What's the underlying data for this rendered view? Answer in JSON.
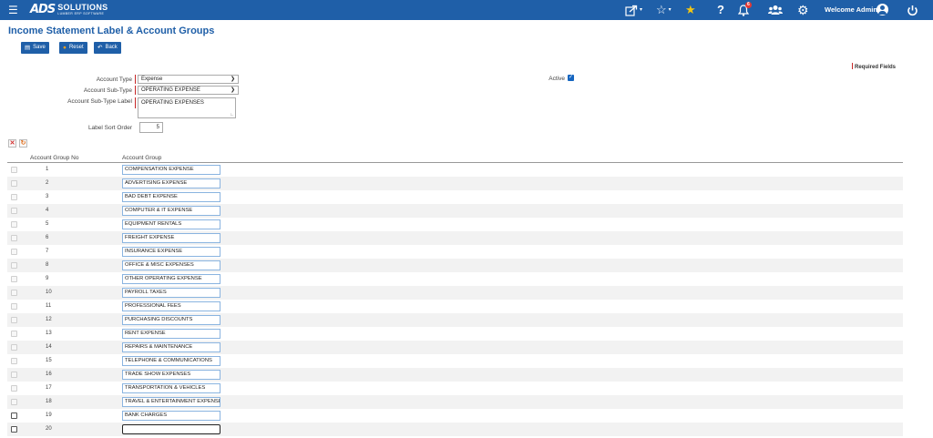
{
  "topbar": {
    "menu_icon": "hamburger-icon",
    "logo_mark": "ADS",
    "logo_name": "SOLUTIONS",
    "logo_tagline": "LUMBER ERP SOFTWARE",
    "icons": [
      "share-icon",
      "star-outline-icon",
      "star-filled-icon",
      "help-icon",
      "bell-icon",
      "users-icon",
      "gear-icon",
      "user-circle-icon",
      "power-icon"
    ],
    "notification_count": "6",
    "welcome_text": "Welcome Admin",
    "color": "#1f5fa8"
  },
  "page": {
    "title": "Income Statement Label & Account Groups",
    "buttons": {
      "save": "Save",
      "reset": "Reset",
      "back": "Back"
    },
    "required_fields": "Required Fields"
  },
  "form": {
    "account_type_label": "Account Type",
    "account_type_value": "Expense",
    "account_subtype_label": "Account Sub-Type",
    "account_subtype_value": "OPERATING EXPENSE",
    "subtype_label_label": "Account Sub-Type Label",
    "subtype_label_value": "OPERATING EXPENSES",
    "sort_order_label": "Label Sort Order",
    "sort_order_value": "5",
    "active_label": "Active",
    "active_checked": true
  },
  "grid": {
    "toolbar_icons": [
      "delete-icon",
      "refresh-icon"
    ],
    "columns": [
      "Account Group No",
      "Account Group"
    ],
    "rows": [
      {
        "no": "1",
        "group": "COMPENSATION EXPENSE"
      },
      {
        "no": "2",
        "group": "ADVERTISING EXPENSE"
      },
      {
        "no": "3",
        "group": "BAD DEBT EXPENSE"
      },
      {
        "no": "4",
        "group": "COMPUTER & IT EXPENSE"
      },
      {
        "no": "5",
        "group": "EQUIPMENT RENTALS"
      },
      {
        "no": "6",
        "group": "FREIGHT EXPENSE"
      },
      {
        "no": "7",
        "group": "INSURANCE EXPENSE"
      },
      {
        "no": "8",
        "group": "OFFICE & MISC EXPENSES"
      },
      {
        "no": "9",
        "group": "OTHER OPERATING EXPENSE"
      },
      {
        "no": "10",
        "group": "PAYROLL TAXES"
      },
      {
        "no": "11",
        "group": "PROFESSIONAL FEES"
      },
      {
        "no": "12",
        "group": "PURCHASING DISCOUNTS"
      },
      {
        "no": "13",
        "group": "RENT EXPENSE"
      },
      {
        "no": "14",
        "group": "REPAIRS & MAINTENANCE"
      },
      {
        "no": "15",
        "group": "TELEPHONE & COMMUNICATIONS"
      },
      {
        "no": "16",
        "group": "TRADE SHOW EXPENSES"
      },
      {
        "no": "17",
        "group": "TRANSPORTATION & VEHICLES"
      },
      {
        "no": "18",
        "group": "TRAVEL & ENTERTAINMENT EXPENSE"
      },
      {
        "no": "19",
        "group": "BANK CHARGES"
      },
      {
        "no": "20",
        "group": ""
      }
    ]
  }
}
